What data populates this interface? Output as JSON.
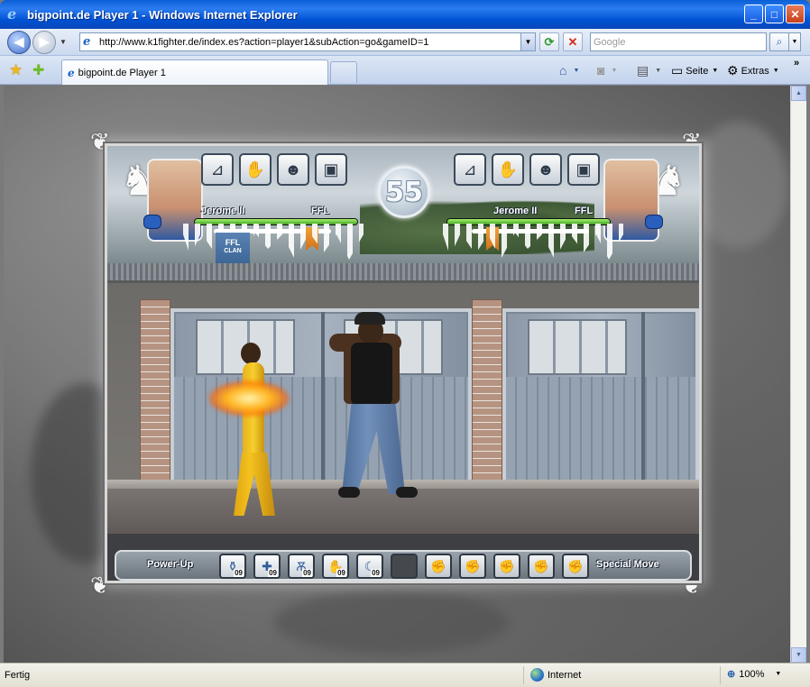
{
  "window": {
    "title": "bigpoint.de Player 1 - Windows Internet Explorer",
    "buttons": [
      "_",
      "□",
      "✕"
    ]
  },
  "address": {
    "url": "http://www.k1fighter.de/index.es?action=player1&subAction=go&gameID=1",
    "search_placeholder": "Google"
  },
  "tabs": [
    {
      "label": "bigpoint.de Player 1"
    }
  ],
  "commandbar": {
    "page_label": "Seite",
    "tools_label": "Extras",
    "overflow": "»"
  },
  "status": {
    "text": "Fertig",
    "zone": "Internet",
    "zoom": "100%"
  },
  "game": {
    "timer": "55",
    "player_left": {
      "name": "Jerome II",
      "tag": "FFL",
      "health": 1.0
    },
    "player_right": {
      "name": "Jerome II",
      "tag": "FFL",
      "health": 1.0
    },
    "clan_badge": {
      "line1": "FFL",
      "line2": "CLAN"
    },
    "attack_icons": [
      "kick-icon",
      "punch-icon",
      "headbutt-icon",
      "block-icon"
    ],
    "powerup_label": "Power-Up",
    "special_label": "Special Move",
    "powerups": [
      {
        "icon": "bottle-icon",
        "count": "09"
      },
      {
        "icon": "bandage-icon",
        "count": "09"
      },
      {
        "icon": "belt-icon",
        "count": "09"
      },
      {
        "icon": "glove-icon",
        "count": "09"
      },
      {
        "icon": "blade-icon",
        "count": "09"
      },
      {
        "icon": "empty-slot",
        "count": ""
      }
    ],
    "special_moves": [
      "fist-icon",
      "fist-icon",
      "fist-icon",
      "fist-icon",
      "fist-icon"
    ],
    "colors": {
      "health": "#3fa322",
      "rank_flag": "#e08a26",
      "fighter_left_suit": "#f2c01e",
      "fighter_right_jeans": "#6787b3"
    }
  }
}
